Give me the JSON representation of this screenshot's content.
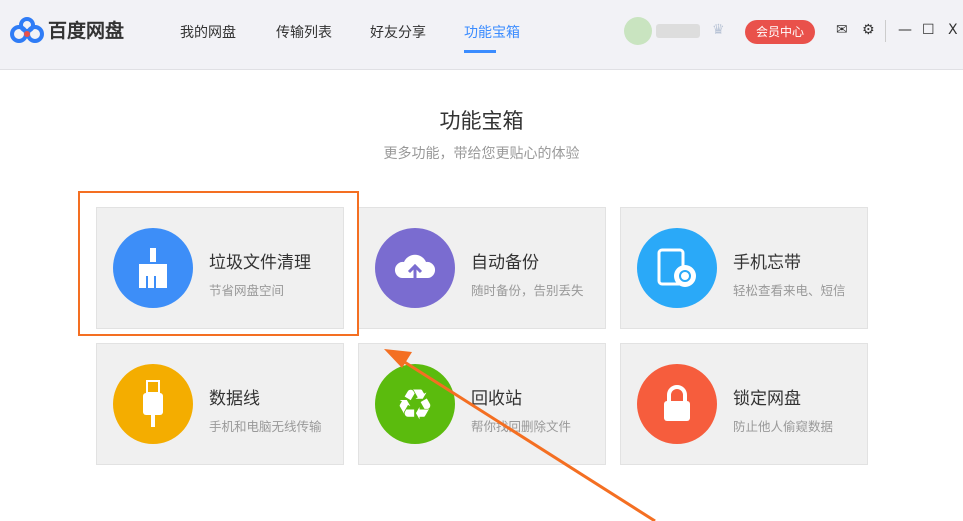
{
  "header": {
    "logo": "百度网盘",
    "nav": [
      "我的网盘",
      "传输列表",
      "好友分享",
      "功能宝箱"
    ],
    "active_nav": 3,
    "vip_button": "会员中心"
  },
  "main": {
    "title": "功能宝箱",
    "subtitle": "更多功能，带给您更贴心的体验",
    "cards": [
      {
        "title": "垃圾文件清理",
        "desc": "节省网盘空间",
        "color": "#3d8ef8",
        "icon": "broom-icon"
      },
      {
        "title": "自动备份",
        "desc": "随时备份，告别丢失",
        "color": "#7a6cd0",
        "icon": "cloud-upload-icon"
      },
      {
        "title": "手机忘带",
        "desc": "轻松查看来电、短信",
        "color": "#2aa9f8",
        "icon": "phone-sync-icon"
      },
      {
        "title": "数据线",
        "desc": "手机和电脑无线传输",
        "color": "#f4ad00",
        "icon": "usb-icon"
      },
      {
        "title": "回收站",
        "desc": "帮你找回删除文件",
        "color": "#5bbb0d",
        "icon": "recycle-icon"
      },
      {
        "title": "锁定网盘",
        "desc": "防止他人偷窥数据",
        "color": "#f65d3d",
        "icon": "lock-icon"
      }
    ]
  }
}
